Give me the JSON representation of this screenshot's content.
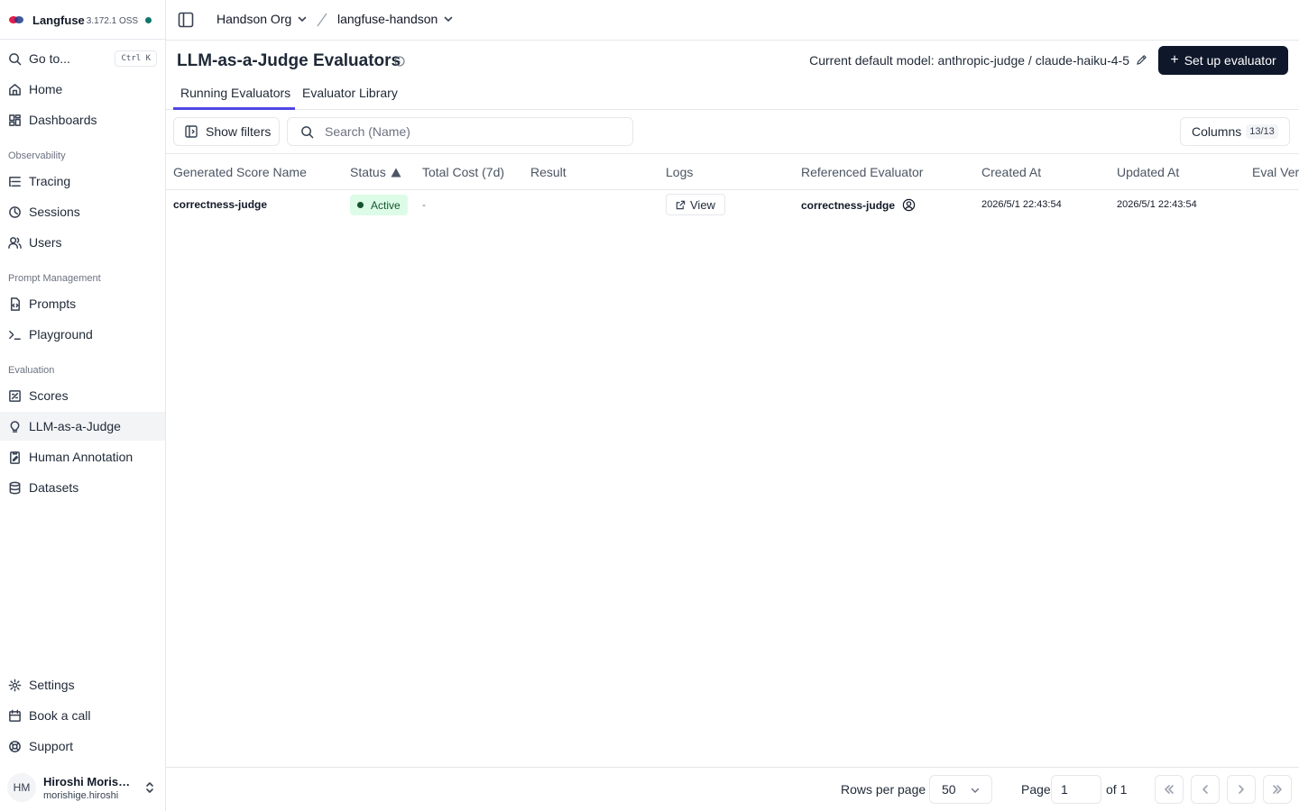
{
  "brand": {
    "name": "Langfuse",
    "version": "3.172.1 OSS"
  },
  "nav": {
    "goto": {
      "label": "Go to...",
      "shortcut": "Ctrl K"
    },
    "home": "Home",
    "dashboards": "Dashboards",
    "groups": {
      "observability": "Observability",
      "prompt_management": "Prompt Management",
      "evaluation": "Evaluation"
    },
    "tracing": "Tracing",
    "sessions": "Sessions",
    "users": "Users",
    "prompts": "Prompts",
    "playground": "Playground",
    "scores": "Scores",
    "llm_judge": "LLM-as-a-Judge",
    "human_annotation": "Human Annotation",
    "datasets": "Datasets",
    "settings": "Settings",
    "book_call": "Book a call",
    "support": "Support"
  },
  "user": {
    "initials": "HM",
    "name": "Hiroshi Morishige",
    "email": "morishige.hiroshi"
  },
  "topbar": {
    "org": "Handson Org",
    "project": "langfuse-handson"
  },
  "page": {
    "title": "LLM-as-a-Judge Evaluators",
    "default_model": "Current default model: anthropic-judge / claude-haiku-4-5",
    "setup_button": "Set up evaluator",
    "tabs": [
      "Running Evaluators",
      "Evaluator Library"
    ]
  },
  "toolbar": {
    "show_filters": "Show filters",
    "search_placeholder": "Search (Name)",
    "columns_label": "Columns",
    "columns_count": "13/13"
  },
  "table": {
    "headers": [
      "Generated Score Name",
      "Status",
      "Total Cost (7d)",
      "Result",
      "Logs",
      "Referenced Evaluator",
      "Created At",
      "Updated At",
      "Eval Vers"
    ],
    "rows": [
      {
        "score_name": "correctness-judge",
        "status": "Active",
        "total_cost": "-",
        "result": "",
        "logs": "View",
        "referenced_evaluator": "correctness-judge",
        "created_at": "2026/5/1 22:43:54",
        "updated_at": "2026/5/1 22:43:54"
      }
    ]
  },
  "footer": {
    "rows_per_page_label": "Rows per page",
    "rows_per_page": "50",
    "page_label": "Page",
    "page": "1",
    "of_label": "of 1"
  },
  "colors": {
    "primary": "#0f172a",
    "tab_active": "#4f46e5",
    "status_bg": "#dcfce7",
    "status_fg": "#14532d"
  }
}
